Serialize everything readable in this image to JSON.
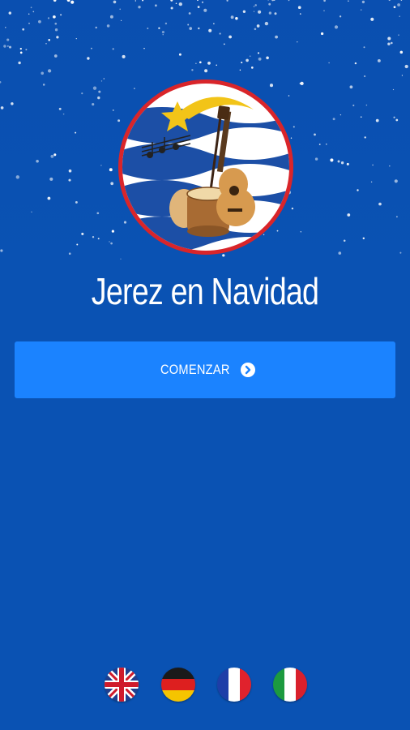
{
  "app": {
    "title": "Jerez en Navidad"
  },
  "start_button": {
    "label": "COMENZAR",
    "icon": "chevron-right-circle-icon"
  },
  "languages": [
    {
      "name": "English",
      "icon": "uk-flag-icon"
    },
    {
      "name": "Deutsch",
      "icon": "germany-flag-icon"
    },
    {
      "name": "Français",
      "icon": "france-flag-icon"
    },
    {
      "name": "Italiano",
      "icon": "italy-flag-icon"
    }
  ],
  "colors": {
    "background": "#0a52b3",
    "button": "#1b83ff",
    "logo_border": "#d9252a"
  }
}
